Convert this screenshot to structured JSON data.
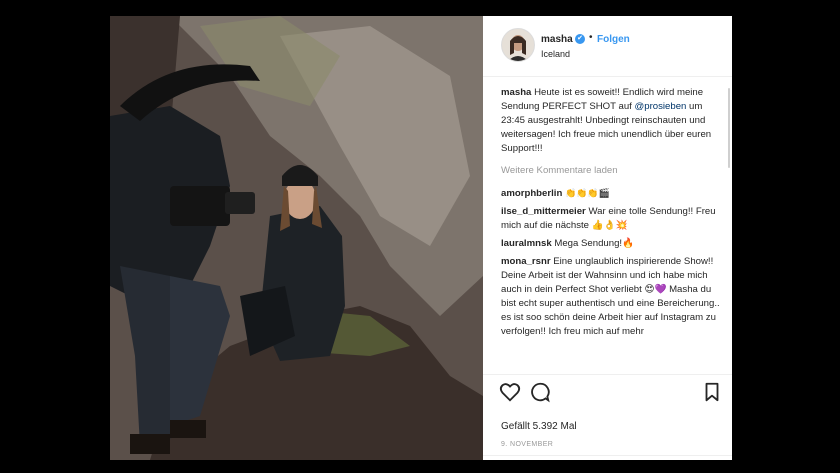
{
  "header": {
    "username": "masha",
    "verified": "✔",
    "separator": "•",
    "follow_label": "Folgen",
    "location": "Iceland"
  },
  "caption": {
    "username": "masha",
    "text_before": "Heute ist es soweit!! Endlich wird meine Sendung PERFECT SHOT auf ",
    "mention": "@prosieben",
    "text_after": " um 23:45 ausgestrahlt! Unbedingt reinschauten und weitersagen! Ich freue mich unendlich über euren Support!!!"
  },
  "load_more_label": "Weitere Kommentare laden",
  "comments": [
    {
      "username": "amorphberlin",
      "text": "👏👏👏🎬"
    },
    {
      "username": "ilse_d_mittermeier",
      "text": "War eine tolle Sendung!! Freu mich auf die nächste 👍👌💥"
    },
    {
      "username": "lauralmnsk",
      "text": "Mega Sendung!🔥"
    },
    {
      "username": "mona_rsnr",
      "text": "Eine unglaublich inspirierende Show!! Deine Arbeit ist der Wahnsinn und ich habe mich auch in dein Perfect Shot verliebt 😍💜 Masha du bist echt super authentisch und eine Bereicherung.. es ist soo schön deine Arbeit hier auf Instagram zu verfolgen!! Ich freu mich auf mehr"
    }
  ],
  "actions": {
    "like_icon": "heart-icon",
    "comment_icon": "comment-bubble-icon",
    "save_icon": "bookmark-icon"
  },
  "likes_label": "Gefällt 5.392 Mal",
  "date_label": "9. NOVEMBER",
  "colors": {
    "link": "#3897f0",
    "mention": "#003569",
    "muted": "#999999"
  }
}
